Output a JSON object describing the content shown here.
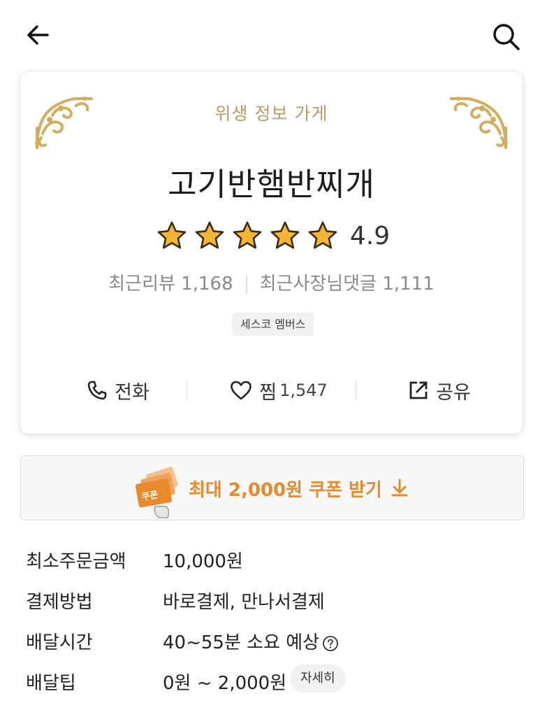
{
  "header": {
    "back_icon": "arrow-left-icon",
    "search_icon": "search-icon"
  },
  "store": {
    "hygiene_label": "위생 정보 가게",
    "name": "고기반햄반찌개",
    "rating": "4.9",
    "rating_value": 4.9,
    "stars_filled": 5,
    "recent_reviews_label": "최근리뷰 1,168",
    "recent_owner_replies_label": "최근사장님댓글 1,111",
    "badge": "세스코 멤버스"
  },
  "actions": {
    "call_label": "전화",
    "like_label": "찜",
    "like_count": "1,547",
    "share_label": "공유"
  },
  "coupon": {
    "label": "최대 2,000원 쿠폰 받기",
    "icon_text": "쿠폰",
    "accent_color": "#e88a2c"
  },
  "info": {
    "min_order_label": "최소주문금액",
    "min_order_value": "10,000원",
    "payment_label": "결제방법",
    "payment_value": "바로결제, 만나서결제",
    "delivery_time_label": "배달시간",
    "delivery_time_value": "40~55분 소요 예상",
    "delivery_tip_label": "배달팁",
    "delivery_tip_value": "0원 ~ 2,000원",
    "detail_button": "자세히"
  },
  "colors": {
    "gold": "#b89a63",
    "star": "#f2b632"
  }
}
